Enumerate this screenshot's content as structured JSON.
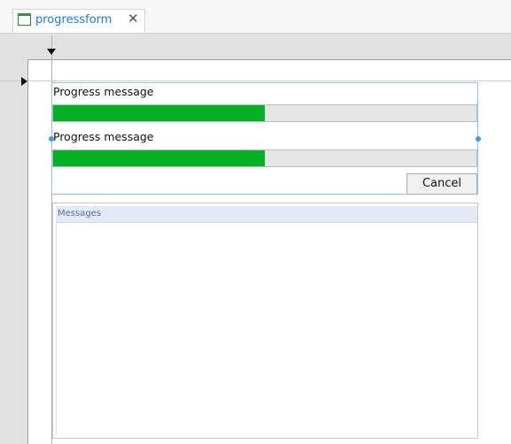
{
  "tab": {
    "label": "progressform",
    "close_glyph": "✕",
    "icon": "form-window-icon"
  },
  "form": {
    "progress": [
      {
        "message": "Progress message",
        "fraction": 0.5
      },
      {
        "message": "Progress message",
        "fraction": 0.5
      }
    ],
    "cancel_label": "Cancel",
    "messages_header": "Messages"
  },
  "colors": {
    "progress_fill": "#06b025",
    "selection": "#3a9be8",
    "tab_text": "#1e7bd8"
  }
}
